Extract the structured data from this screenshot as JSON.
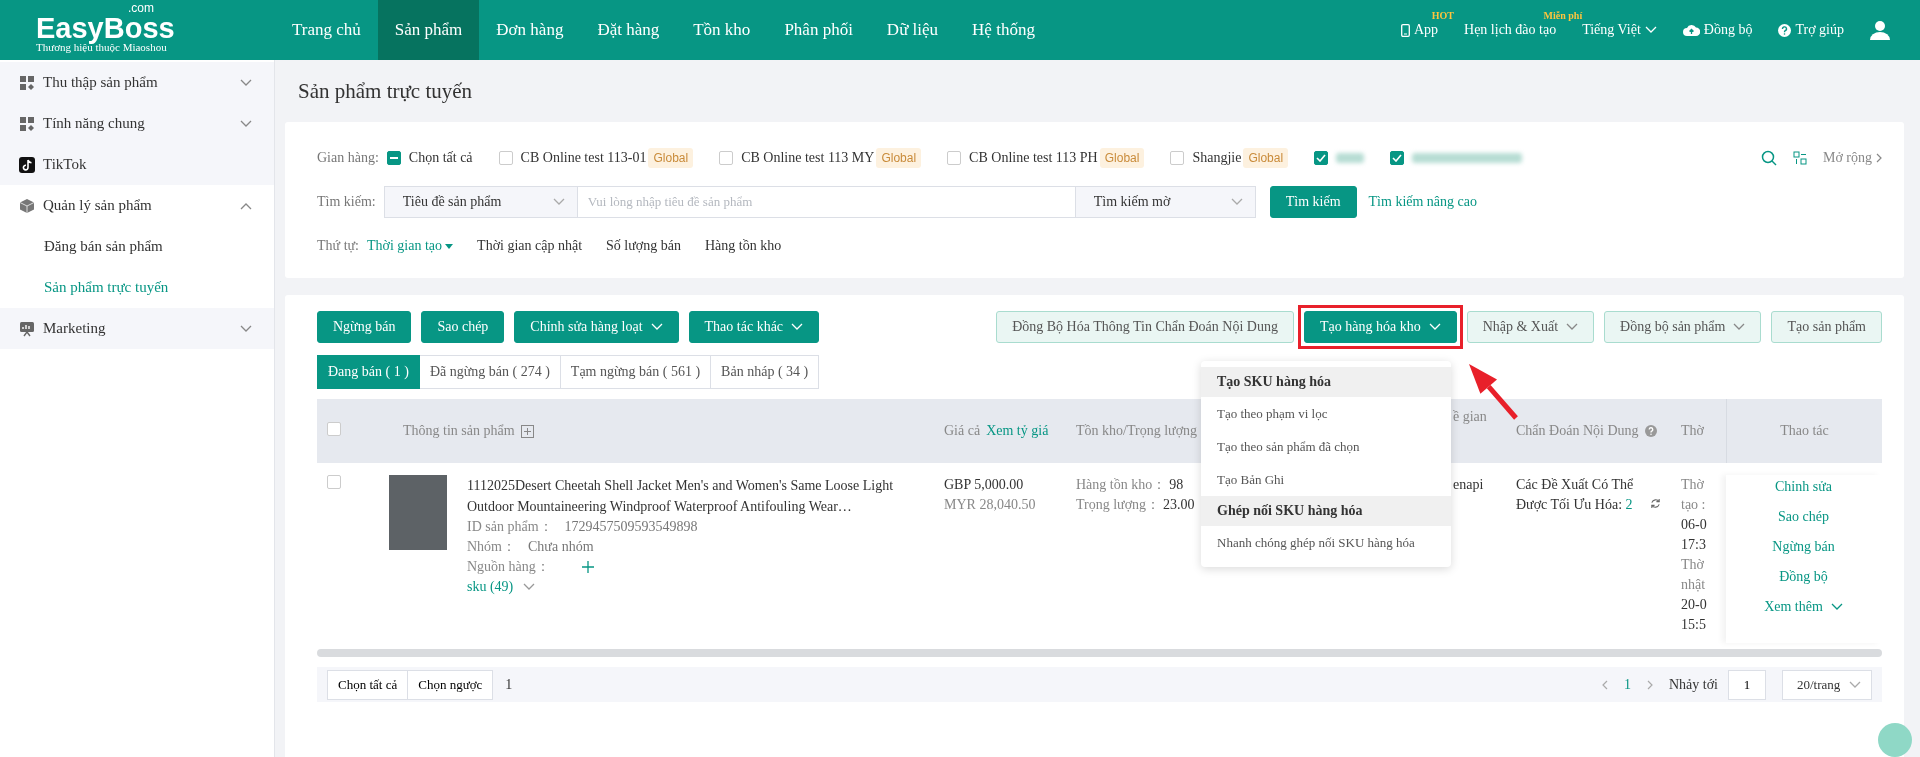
{
  "header": {
    "logo": "EasyBoss",
    "logo_suffix": ".com",
    "tagline": "Thương hiệu thuộc Miaoshou",
    "nav": [
      {
        "label": "Trang chủ",
        "selected": false
      },
      {
        "label": "Sản phẩm",
        "selected": true
      },
      {
        "label": "Đơn hàng",
        "selected": false
      },
      {
        "label": "Đặt hàng",
        "selected": false
      },
      {
        "label": "Tồn kho",
        "selected": false
      },
      {
        "label": "Phân phối",
        "selected": false
      },
      {
        "label": "Dữ liệu",
        "selected": false
      },
      {
        "label": "Hệ thống",
        "selected": false
      }
    ],
    "right": [
      {
        "kind": "app",
        "label": "App",
        "badge": "HOT"
      },
      {
        "kind": "link",
        "label": "Hẹn lịch đào tạo",
        "badge": "Miễn phí"
      },
      {
        "kind": "dropdown",
        "label": "Tiếng Việt"
      },
      {
        "kind": "sync",
        "label": "Đồng bộ"
      },
      {
        "kind": "help",
        "label": "Trợ giúp"
      }
    ]
  },
  "sidebar": {
    "items": [
      {
        "label": "Thu thập sản phẩm",
        "expanded": false
      },
      {
        "label": "Tính năng chung",
        "expanded": false
      },
      {
        "label": "TikTok"
      },
      {
        "label": "Quản lý sản phẩm",
        "expanded": true,
        "children": [
          {
            "label": "Đăng bán sản phẩm",
            "selected": false
          },
          {
            "label": "Sản phẩm trực tuyến",
            "selected": true
          }
        ]
      },
      {
        "label": "Marketing",
        "expanded": false
      }
    ]
  },
  "page_title": "Sản phẩm trực tuyến",
  "filters": {
    "store_label": "Gian hàng:",
    "select_all": {
      "label": "Chọn tất cả",
      "indeterminate": true
    },
    "stores": [
      {
        "kind": "store",
        "name": "CB Online test 113-01",
        "tag": "Global",
        "checked": false
      },
      {
        "kind": "store",
        "name": "CB Online test 113 MY",
        "tag": "Global",
        "checked": false
      },
      {
        "kind": "store",
        "name": "CB Online test 113 PH",
        "tag": "Global",
        "checked": false
      },
      {
        "kind": "store",
        "name": "Shangjie",
        "tag": "Global",
        "checked": false
      },
      {
        "kind": "redacted",
        "checked": true
      },
      {
        "kind": "redacted",
        "checked": true
      }
    ],
    "expand_label": "Mở rộng",
    "search": {
      "label": "Tìm kiếm:",
      "field": "Tiêu đề sản phẩm",
      "placeholder": "Vui lòng nhập tiêu đề sản phẩm",
      "mode": "Tìm kiếm mờ",
      "button": "Tìm kiếm",
      "advanced": "Tìm kiếm nâng cao"
    },
    "sort": {
      "label": "Thứ tự:",
      "options": [
        {
          "label": "Thời gian tạo",
          "selected": true
        },
        {
          "label": "Thời gian cập nhật",
          "selected": false
        },
        {
          "label": "Số lượng bán",
          "selected": false
        },
        {
          "label": "Hàng tồn kho",
          "selected": false
        }
      ]
    }
  },
  "toolbar": {
    "left": [
      {
        "label": "Ngừng bán",
        "kind": "primary"
      },
      {
        "label": "Sao chép",
        "kind": "primary"
      },
      {
        "label": "Chỉnh sửa hàng loạt",
        "kind": "primary-dropdown"
      },
      {
        "label": "Thao tác khác",
        "kind": "primary-dropdown"
      }
    ],
    "right": [
      {
        "label": "Đồng Bộ Hóa Thông Tin Chẩn Đoán Nội Dung",
        "kind": "light",
        "highlighted": false
      },
      {
        "label": "Tạo hàng hóa kho",
        "kind": "primary-dropdown",
        "highlighted": true
      },
      {
        "label": "Nhập & Xuất",
        "kind": "light-dropdown",
        "highlighted": false
      },
      {
        "label": "Đồng bộ sản phẩm",
        "kind": "light-dropdown",
        "highlighted": false
      },
      {
        "label": "Tạo sản phẩm",
        "kind": "light",
        "highlighted": false
      }
    ]
  },
  "tabs": [
    {
      "label": "Đang bán ( 1 )",
      "selected": true
    },
    {
      "label": "Đã ngừng bán ( 274 )",
      "selected": false
    },
    {
      "label": "Tạm ngừng bán ( 561 )",
      "selected": false
    },
    {
      "label": "Bản nháp ( 34 )",
      "selected": false
    }
  ],
  "dropdown": {
    "groups": [
      {
        "title": "Tạo SKU hàng hóa",
        "items": [
          "Tạo theo phạm vi lọc",
          "Tạo theo sản phẩm đã chọn",
          "Tạo Bản Ghi"
        ]
      },
      {
        "title": "Ghép nối SKU hàng hóa",
        "items": [
          "Nhanh chóng ghép nối SKU hàng hóa"
        ]
      }
    ]
  },
  "table": {
    "select_all_checked": false,
    "columns": [
      {
        "label": "Thông tin sản phẩm"
      },
      {
        "label": "Giá cả",
        "link": "Xem tỷ giá"
      },
      {
        "label": "Tồn kho/Trọng lượng"
      },
      {
        "label": "ề gian"
      },
      {
        "label": "Chẩn Đoán Nội Dung"
      },
      {
        "label": "Thờ"
      },
      {
        "label": "Thao tác"
      }
    ],
    "rows": [
      {
        "checked": false,
        "title": "1112025Desert Cheetah Shell Jacket Men's and Women's Same Loose Light Outdoor Mountaineering Windproof Waterproof Antifouling Wear…",
        "meta": [
          {
            "label": "ID sản phẩm：",
            "value": "1729457509593549898"
          },
          {
            "label": "Nhóm：",
            "value": "Chưa nhóm"
          },
          {
            "label": "Nguồn hàng："
          }
        ],
        "sku": "sku (49)",
        "price": "GBP 5,000.00",
        "price_converted": "MYR 28,040.50",
        "stock": [
          {
            "label": "Hàng tồn kho：",
            "value": "98"
          },
          {
            "label": "Trọng lượng：",
            "value": "23.00"
          }
        ],
        "column_5": "enapi",
        "diagnosis": "Các Đề Xuất Có Thể Được Tối Ưu Hóa:",
        "diagnosis_count": "2",
        "time": [
          {
            "text": "Thờ",
            "kind": "label"
          },
          {
            "text": "tạo :",
            "kind": "label"
          },
          {
            "text": "06-0",
            "kind": "value"
          },
          {
            "text": "17:3",
            "kind": "value"
          },
          {
            "text": "Thờ",
            "kind": "label"
          },
          {
            "text": "nhật",
            "kind": "label"
          },
          {
            "text": "20-0",
            "kind": "value"
          },
          {
            "text": "15:5",
            "kind": "value"
          }
        ],
        "actions": [
          "Chỉnh sửa",
          "Sao chép",
          "Ngừng bán",
          "Đồng bộ",
          "Xem thêm"
        ]
      }
    ]
  },
  "footer": {
    "buttons": [
      "Chọn tất cả",
      "Chọn ngược"
    ],
    "count": "1",
    "page": "1",
    "jump_label": "Nhảy tới",
    "jump_value": "1",
    "page_size": "20/trang"
  }
}
